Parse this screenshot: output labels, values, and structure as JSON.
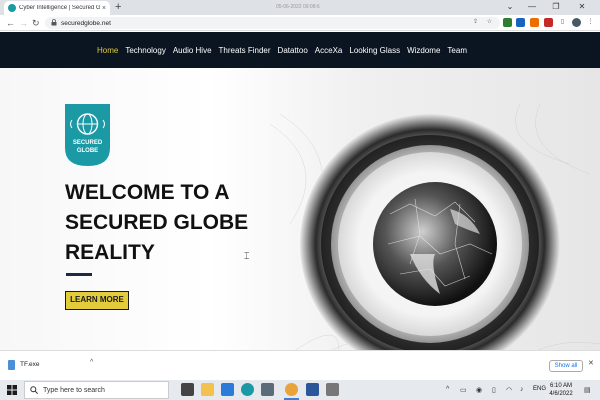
{
  "browser": {
    "tab_title": "Cyber Intelligence | Secured Glob",
    "tab_close": "×",
    "new_tab": "+",
    "timestamp": "05-06-2022  09:08:6",
    "win_min": "⌄",
    "win_minimize": "—",
    "win_restore": "❐",
    "win_close": "✕",
    "back": "←",
    "forward": "→",
    "reload": "↻",
    "url": "securedglobe.net",
    "lock": "🔒"
  },
  "site": {
    "nav": [
      "Home",
      "Technology",
      "Audio Hive",
      "Threats Finder",
      "Datattoo",
      "AcceXa",
      "Looking Glass",
      "Wizdome",
      "Team"
    ],
    "active_nav": "Home",
    "logo_text_1": "SECURED",
    "logo_text_2": "GLOBE",
    "headline_1": "WELCOME TO A",
    "headline_2": "SECURED GLOBE",
    "headline_3": "REALITY",
    "cta_label": "LEARN MORE",
    "accent_color": "#e2cc3c",
    "navbar_color": "#0b1521"
  },
  "downloads": {
    "file_name": "TF.exe",
    "chevron": "^",
    "show_all": "Show all",
    "close": "✕"
  },
  "taskbar": {
    "search_placeholder": "Type here to search",
    "language": "ENG",
    "time": "6:10 AM",
    "date": "4/6/2022"
  }
}
